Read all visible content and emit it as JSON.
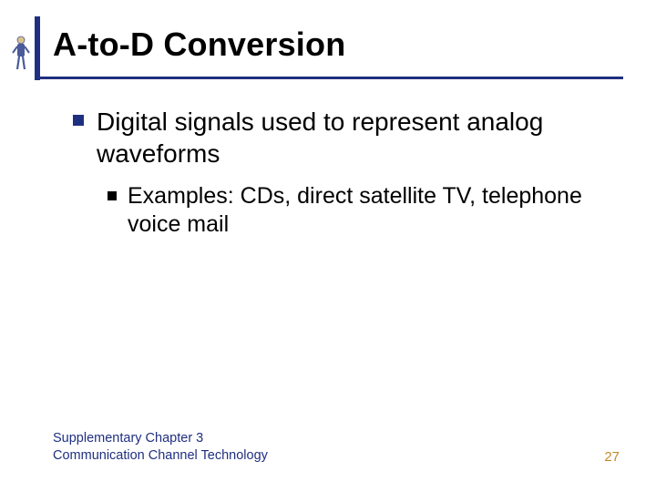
{
  "title": "A-to-D Conversion",
  "bullets": {
    "lvl1": "Digital signals used to represent analog waveforms",
    "lvl2": "Examples:  CDs, direct satellite TV, telephone voice mail"
  },
  "footer": {
    "line1": "Supplementary Chapter 3",
    "line2": "Communication Channel Technology",
    "pagenum": "27"
  },
  "colors": {
    "accent_navy": "#1f2f80",
    "pagenum_gold": "#c08a2e"
  }
}
